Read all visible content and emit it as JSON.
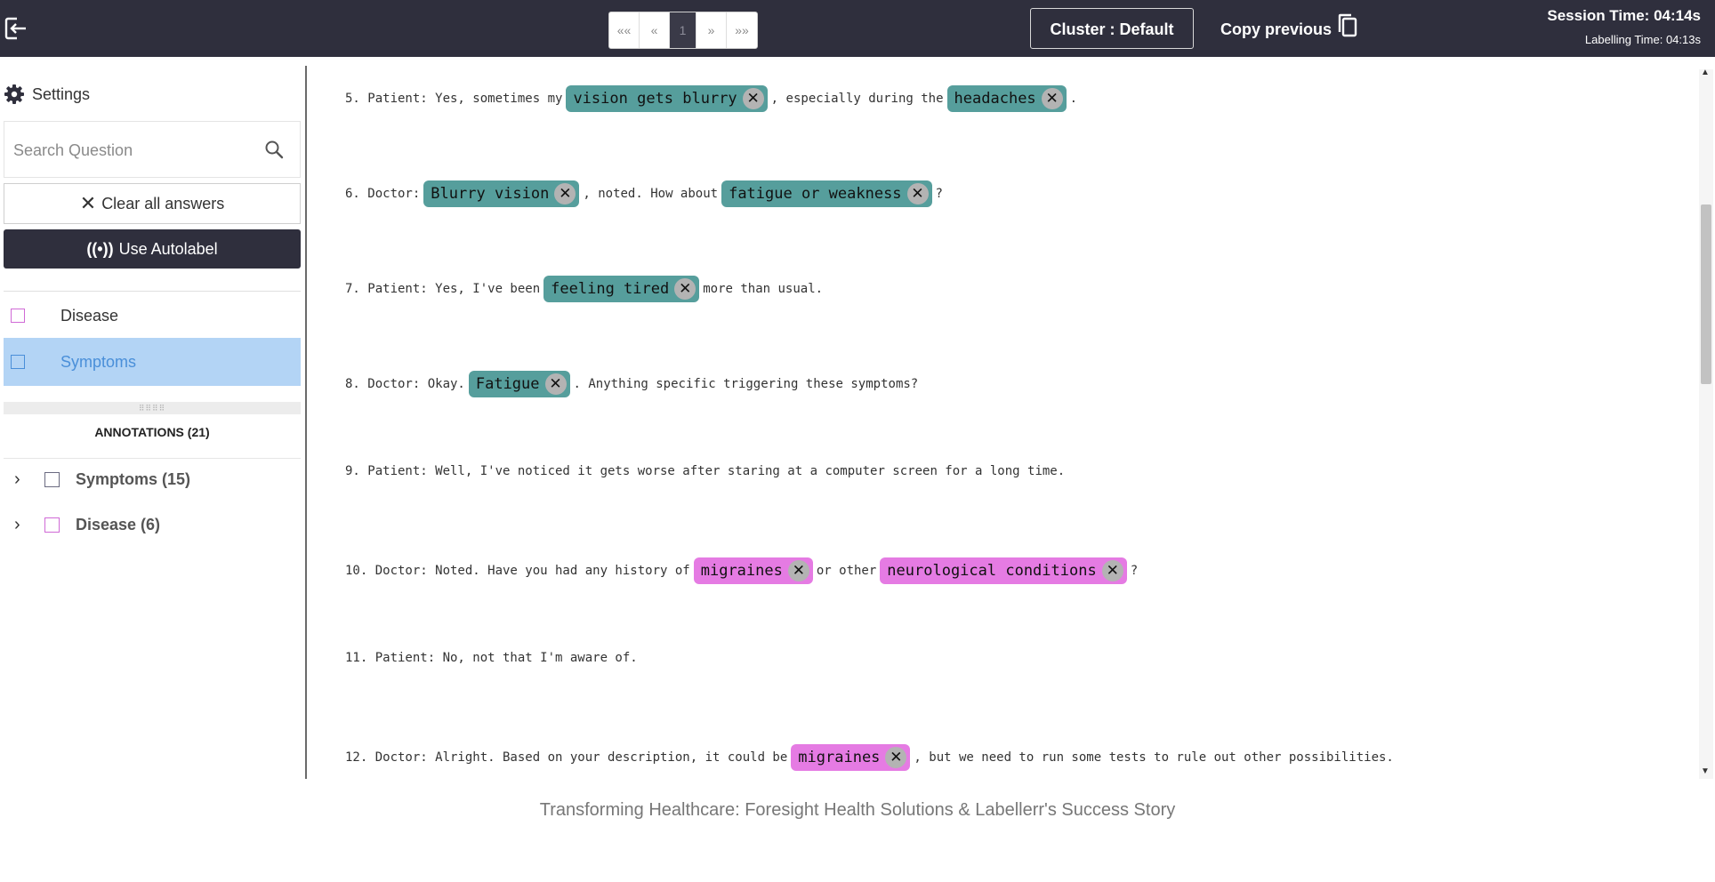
{
  "header": {
    "pagination": {
      "first": "««",
      "prev": "«",
      "current": "1",
      "next": "»",
      "last": "»»"
    },
    "cluster_button": "Cluster : Default",
    "copy_previous": "Copy previous",
    "session_time": "Session Time: 04:14s",
    "labelling_time": "Labelling Time: 04:13s"
  },
  "sidebar": {
    "settings_label": "Settings",
    "search_placeholder": "Search Question",
    "clear_all": "Clear all answers",
    "autolabel": "Use Autolabel",
    "labels": [
      {
        "name": "Disease",
        "color": "#d06ad6"
      },
      {
        "name": "Symptoms",
        "color": "#4a8fd9"
      }
    ],
    "annotations_header": "ANNOTATIONS (21)",
    "annotation_groups": [
      {
        "label": "Symptoms (15)"
      },
      {
        "label": "Disease (6)"
      }
    ]
  },
  "transcript": {
    "l5": {
      "a": "5. Patient: Yes, sometimes my",
      "t1": "vision gets blurry",
      "b": ", especially during the",
      "t2": "headaches",
      "c": "."
    },
    "l6": {
      "a": "6. Doctor:",
      "t1": "Blurry vision",
      "b": ", noted. How about",
      "t2": "fatigue or weakness",
      "c": "?"
    },
    "l7": {
      "a": "7. Patient: Yes, I've been",
      "t1": "feeling tired",
      "b": "more than usual."
    },
    "l8": {
      "a": "8. Doctor: Okay.",
      "t1": "Fatigue",
      "b": ". Anything specific triggering these symptoms?"
    },
    "l9": {
      "a": "9. Patient: Well, I've noticed it gets worse after staring at a computer screen for a long time."
    },
    "l10": {
      "a": "10. Doctor: Noted. Have you had any history of",
      "t1": "migraines",
      "b": "or other",
      "t2": "neurological conditions",
      "c": "?"
    },
    "l11": {
      "a": "11. Patient: No, not that I'm aware of."
    },
    "l12": {
      "a": "12. Doctor: Alright. Based on your description, it could be",
      "t1": "migraines",
      "b": ", but we need to run some tests to rule out other possibilities."
    }
  },
  "colors": {
    "symptom_tag": "#569e9c",
    "disease_tag": "#e57be3",
    "topbar": "#2f2f3d"
  },
  "caption": "Transforming Healthcare: Foresight Health Solutions & Labellerr's Success Story"
}
